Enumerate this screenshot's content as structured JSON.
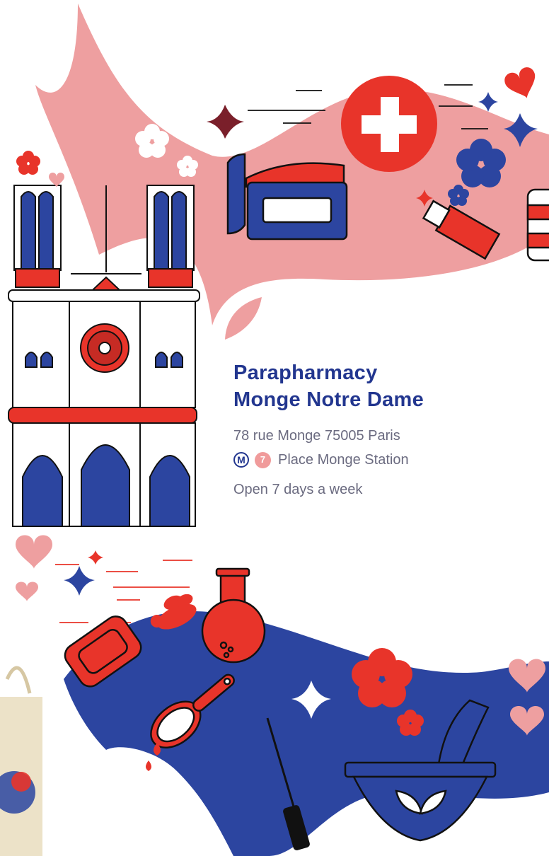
{
  "store": {
    "name_line1": "Parapharmacy",
    "name_line2": "Monge Notre Dame",
    "address": "78 rue Monge 75005 Paris",
    "metro_badge": "M",
    "metro_line": "7",
    "station": "Place Monge Station",
    "hours": "Open 7 days a week"
  },
  "colors": {
    "navy": "#22368f",
    "red": "#e8342a",
    "pink": "#ee9fa0",
    "gray_text": "#6b6b80"
  },
  "icons": [
    "notre-dame-cathedral-icon",
    "pharmacy-cross-icon",
    "cream-jar-icon",
    "lotion-tube-icon",
    "hairbrush-icon",
    "mortar-pestle-icon",
    "soap-icon",
    "flask-icon",
    "bee-icon",
    "mascara-icon",
    "tote-bag-icon",
    "flower-icon",
    "sparkle-icon",
    "heart-icon"
  ]
}
